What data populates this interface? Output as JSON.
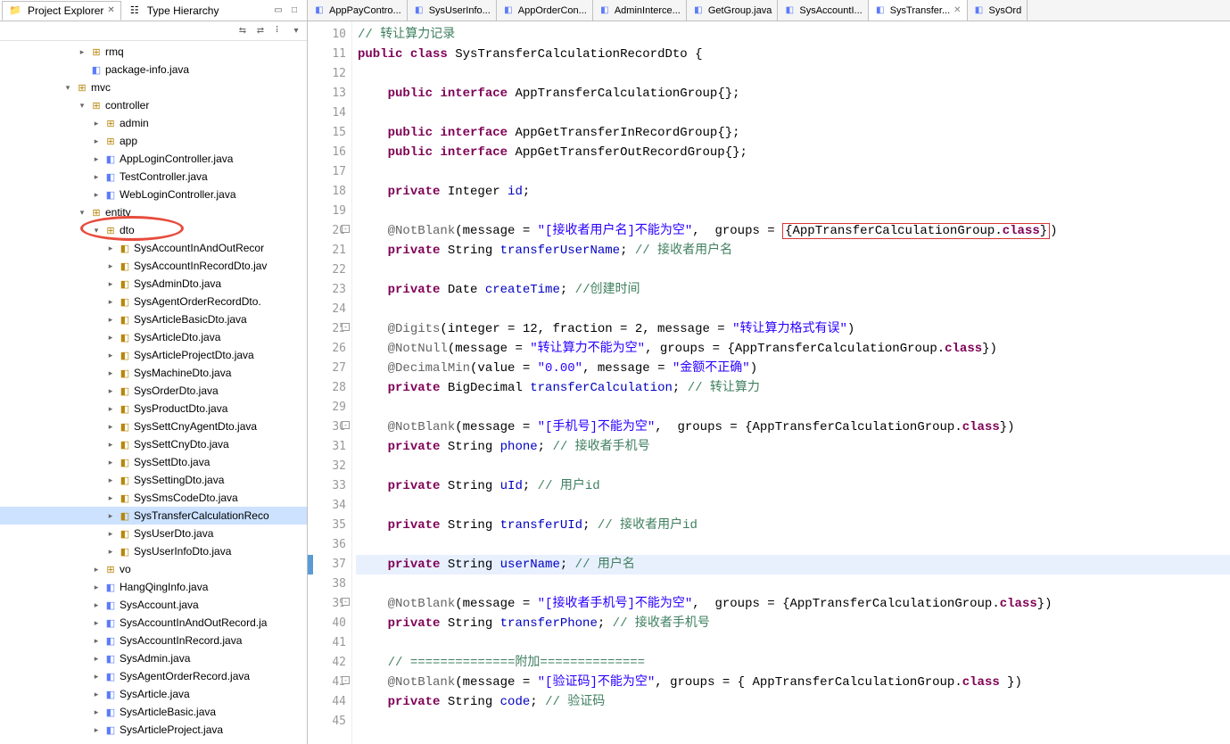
{
  "sidebar": {
    "tabs": [
      {
        "label": "Project Explorer",
        "active": true
      },
      {
        "label": "Type Hierarchy",
        "active": false
      }
    ],
    "tree": [
      {
        "depth": 5,
        "arrow": ">",
        "icon": "pkg",
        "label": "rmq"
      },
      {
        "depth": 5,
        "arrow": "",
        "icon": "java",
        "label": "package-info.java"
      },
      {
        "depth": 4,
        "arrow": "v",
        "icon": "pkg",
        "label": "mvc"
      },
      {
        "depth": 5,
        "arrow": "v",
        "icon": "pkg",
        "label": "controller"
      },
      {
        "depth": 6,
        "arrow": ">",
        "icon": "pkg",
        "label": "admin"
      },
      {
        "depth": 6,
        "arrow": ">",
        "icon": "pkg",
        "label": "app"
      },
      {
        "depth": 6,
        "arrow": ">",
        "icon": "java",
        "label": "AppLoginController.java"
      },
      {
        "depth": 6,
        "arrow": ">",
        "icon": "java",
        "label": "TestController.java"
      },
      {
        "depth": 6,
        "arrow": ">",
        "icon": "java",
        "label": "WebLoginController.java"
      },
      {
        "depth": 5,
        "arrow": "v",
        "icon": "pkg",
        "label": "entity"
      },
      {
        "depth": 6,
        "arrow": "v",
        "icon": "pkg",
        "label": "dto",
        "circled": true
      },
      {
        "depth": 7,
        "arrow": ">",
        "icon": "java-w",
        "label": "SysAccountInAndOutRecor"
      },
      {
        "depth": 7,
        "arrow": ">",
        "icon": "java-w",
        "label": "SysAccountInRecordDto.jav"
      },
      {
        "depth": 7,
        "arrow": ">",
        "icon": "java-w",
        "label": "SysAdminDto.java"
      },
      {
        "depth": 7,
        "arrow": ">",
        "icon": "java-w",
        "label": "SysAgentOrderRecordDto."
      },
      {
        "depth": 7,
        "arrow": ">",
        "icon": "java-w",
        "label": "SysArticleBasicDto.java"
      },
      {
        "depth": 7,
        "arrow": ">",
        "icon": "java-w",
        "label": "SysArticleDto.java"
      },
      {
        "depth": 7,
        "arrow": ">",
        "icon": "java-w",
        "label": "SysArticleProjectDto.java"
      },
      {
        "depth": 7,
        "arrow": ">",
        "icon": "java-w",
        "label": "SysMachineDto.java"
      },
      {
        "depth": 7,
        "arrow": ">",
        "icon": "java-w",
        "label": "SysOrderDto.java"
      },
      {
        "depth": 7,
        "arrow": ">",
        "icon": "java-w",
        "label": "SysProductDto.java"
      },
      {
        "depth": 7,
        "arrow": ">",
        "icon": "java-w",
        "label": "SysSettCnyAgentDto.java"
      },
      {
        "depth": 7,
        "arrow": ">",
        "icon": "java-w",
        "label": "SysSettCnyDto.java"
      },
      {
        "depth": 7,
        "arrow": ">",
        "icon": "java-w",
        "label": "SysSettDto.java"
      },
      {
        "depth": 7,
        "arrow": ">",
        "icon": "java-w",
        "label": "SysSettingDto.java"
      },
      {
        "depth": 7,
        "arrow": ">",
        "icon": "java-w",
        "label": "SysSmsCodeDto.java"
      },
      {
        "depth": 7,
        "arrow": ">",
        "icon": "java-w",
        "label": "SysTransferCalculationReco",
        "selected": true
      },
      {
        "depth": 7,
        "arrow": ">",
        "icon": "java-w",
        "label": "SysUserDto.java"
      },
      {
        "depth": 7,
        "arrow": ">",
        "icon": "java-w",
        "label": "SysUserInfoDto.java"
      },
      {
        "depth": 6,
        "arrow": ">",
        "icon": "pkg",
        "label": "vo"
      },
      {
        "depth": 6,
        "arrow": ">",
        "icon": "java",
        "label": "HangQingInfo.java"
      },
      {
        "depth": 6,
        "arrow": ">",
        "icon": "java",
        "label": "SysAccount.java"
      },
      {
        "depth": 6,
        "arrow": ">",
        "icon": "java",
        "label": "SysAccountInAndOutRecord.ja"
      },
      {
        "depth": 6,
        "arrow": ">",
        "icon": "java",
        "label": "SysAccountInRecord.java"
      },
      {
        "depth": 6,
        "arrow": ">",
        "icon": "java",
        "label": "SysAdmin.java"
      },
      {
        "depth": 6,
        "arrow": ">",
        "icon": "java",
        "label": "SysAgentOrderRecord.java"
      },
      {
        "depth": 6,
        "arrow": ">",
        "icon": "java",
        "label": "SysArticle.java"
      },
      {
        "depth": 6,
        "arrow": ">",
        "icon": "java",
        "label": "SysArticleBasic.java"
      },
      {
        "depth": 6,
        "arrow": ">",
        "icon": "java",
        "label": "SysArticleProject.java"
      }
    ]
  },
  "editor": {
    "tabs": [
      {
        "label": "AppPayContro...",
        "active": false
      },
      {
        "label": "SysUserInfo...",
        "active": false
      },
      {
        "label": "AppOrderCon...",
        "active": false
      },
      {
        "label": "AdminInterce...",
        "active": false
      },
      {
        "label": "GetGroup.java",
        "active": false
      },
      {
        "label": "SysAccountI...",
        "active": false
      },
      {
        "label": "SysTransfer...",
        "active": true
      },
      {
        "label": "SysOrd",
        "active": false
      }
    ],
    "startLine": 10,
    "foldLines": [
      20,
      25,
      30,
      39,
      43
    ],
    "highlightLine": 37,
    "lines": [
      {
        "n": 10,
        "html": "<span class='cmt'>// 转让算力记录</span>"
      },
      {
        "n": 11,
        "html": "<span class='kw'>public</span> <span class='kw'>class</span> <span class='cls'>SysTransferCalculationRecordDto</span> {"
      },
      {
        "n": 12,
        "html": ""
      },
      {
        "n": 13,
        "html": "    <span class='kw'>public</span> <span class='kw'>interface</span> <span class='cls'>AppTransferCalculationGroup</span>{};"
      },
      {
        "n": 14,
        "html": ""
      },
      {
        "n": 15,
        "html": "    <span class='kw'>public</span> <span class='kw'>interface</span> <span class='cls'>AppGetTransferInRecordGroup</span>{};"
      },
      {
        "n": 16,
        "html": "    <span class='kw'>public</span> <span class='kw'>interface</span> <span class='cls'>AppGetTransferOutRecordGroup</span>{};"
      },
      {
        "n": 17,
        "html": ""
      },
      {
        "n": 18,
        "html": "    <span class='kw'>private</span> Integer <span class='fld'>id</span>;"
      },
      {
        "n": 19,
        "html": ""
      },
      {
        "n": 20,
        "html": "    <span class='ann'>@NotBlank</span>(message = <span class='str'>\"[接收者用户名]不能为空\"</span>,  groups = <span class='box-red'>{AppTransferCalculationGroup.<span class='kw'>class</span>}</span>)"
      },
      {
        "n": 21,
        "html": "    <span class='kw'>private</span> String <span class='fld'>transferUserName</span>; <span class='cmt'>// 接收者用户名</span>"
      },
      {
        "n": 22,
        "html": ""
      },
      {
        "n": 23,
        "html": "    <span class='kw'>private</span> Date <span class='fld'>createTime</span>; <span class='cmt'>//创建时间</span>"
      },
      {
        "n": 24,
        "html": ""
      },
      {
        "n": 25,
        "html": "    <span class='ann'>@Digits</span>(integer = 12, fraction = 2, message = <span class='str'>\"转让算力格式有误\"</span>)"
      },
      {
        "n": 26,
        "html": "    <span class='ann'>@NotNull</span>(message = <span class='str'>\"转让算力不能为空\"</span>, groups = {AppTransferCalculationGroup.<span class='kw'>class</span>})"
      },
      {
        "n": 27,
        "html": "    <span class='ann'>@DecimalMin</span>(value = <span class='str'>\"0.00\"</span>, message = <span class='str'>\"金额不正确\"</span>)"
      },
      {
        "n": 28,
        "html": "    <span class='kw'>private</span> BigDecimal <span class='fld'>transferCalculation</span>; <span class='cmt'>// 转让算力</span>"
      },
      {
        "n": 29,
        "html": ""
      },
      {
        "n": 30,
        "html": "    <span class='ann'>@NotBlank</span>(message = <span class='str'>\"[手机号]不能为空\"</span>,  groups = {AppTransferCalculationGroup.<span class='kw'>class</span>})"
      },
      {
        "n": 31,
        "html": "    <span class='kw'>private</span> String <span class='fld'>phone</span>; <span class='cmt'>// 接收者手机号</span>"
      },
      {
        "n": 32,
        "html": ""
      },
      {
        "n": 33,
        "html": "    <span class='kw'>private</span> String <span class='fld'>uId</span>; <span class='cmt'>// 用户id</span>"
      },
      {
        "n": 34,
        "html": ""
      },
      {
        "n": 35,
        "html": "    <span class='kw'>private</span> String <span class='fld'>transferUId</span>; <span class='cmt'>// 接收者用户id</span>"
      },
      {
        "n": 36,
        "html": ""
      },
      {
        "n": 37,
        "html": "    <span class='kw'>private</span> String <span class='fld'>userName</span>; <span class='cmt'>// 用户名</span>"
      },
      {
        "n": 38,
        "html": ""
      },
      {
        "n": 39,
        "html": "    <span class='ann'>@NotBlank</span>(message = <span class='str'>\"[接收者手机号]不能为空\"</span>,  groups = {AppTransferCalculationGroup.<span class='kw'>class</span>})"
      },
      {
        "n": 40,
        "html": "    <span class='kw'>private</span> String <span class='fld'>transferPhone</span>; <span class='cmt'>// 接收者手机号</span>"
      },
      {
        "n": 41,
        "html": ""
      },
      {
        "n": 42,
        "html": "    <span class='cmt'>// ==============附加==============</span>"
      },
      {
        "n": 43,
        "html": "    <span class='ann'>@NotBlank</span>(message = <span class='str'>\"[验证码]不能为空\"</span>, groups = { AppTransferCalculationGroup.<span class='kw'>class</span> })"
      },
      {
        "n": 44,
        "html": "    <span class='kw'>private</span> String <span class='fld'>code</span>; <span class='cmt'>// 验证码</span>"
      },
      {
        "n": 45,
        "html": ""
      }
    ]
  }
}
